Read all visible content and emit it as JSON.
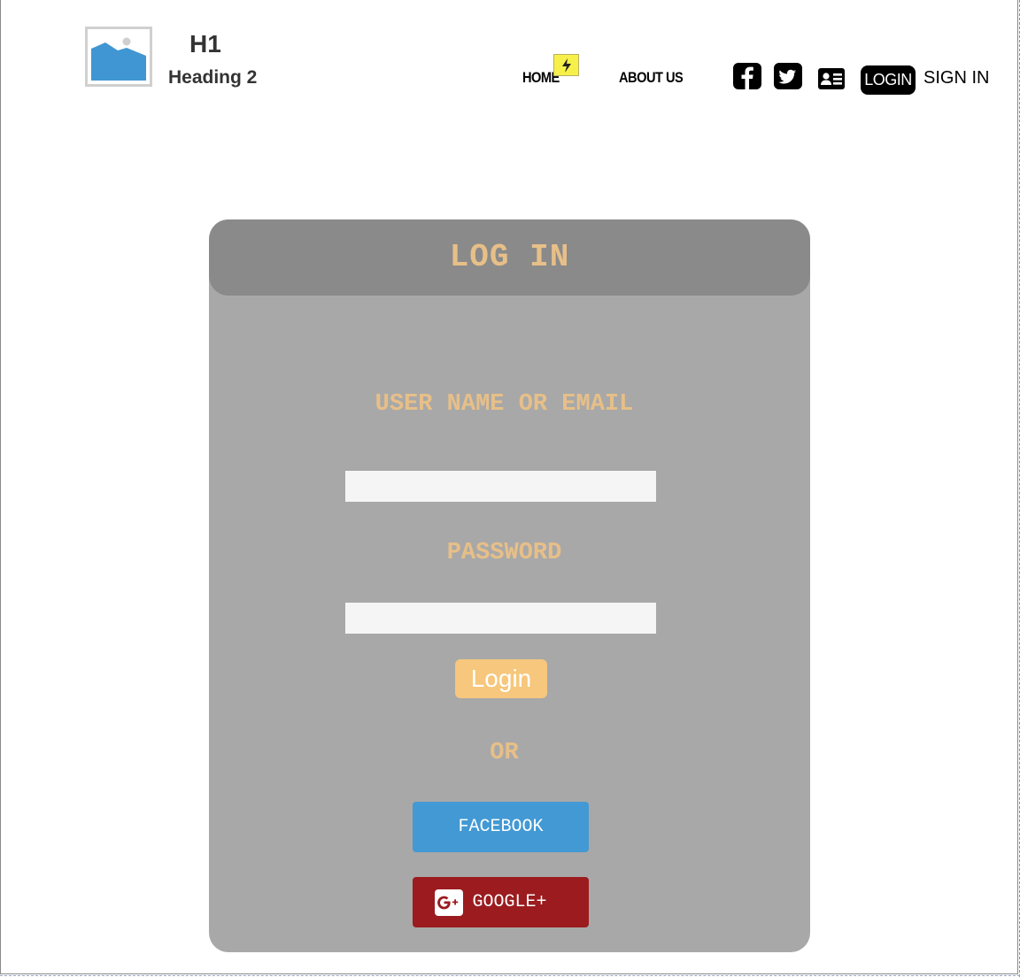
{
  "header": {
    "logo_icon": "image-placeholder-icon",
    "h1": "H1",
    "h2": "Heading 2",
    "nav": [
      {
        "label": "HOME"
      },
      {
        "label": "ABOUT US"
      }
    ],
    "flash_icon": "lightning-icon",
    "social_icons": [
      "facebook-icon",
      "twitter-icon",
      "contact-card-icon"
    ],
    "login_label": "LOGIN",
    "signin_label": "SIGN IN"
  },
  "login_form": {
    "title": "LOG IN",
    "username_label": "USER NAME OR EMAIL",
    "username_value": "",
    "password_label": "PASSWORD",
    "password_value": "",
    "submit_label": "Login",
    "or_label": "OR",
    "facebook_label": "FACEBOOK",
    "google_label": "GOOGLE+"
  },
  "colors": {
    "card_bg": "#a8a8a8",
    "card_header_bg": "#8a8a8a",
    "accent_text": "#e7bf88",
    "login_button": "#f6c77c",
    "facebook": "#4299d4",
    "google": "#9b1b1e"
  }
}
